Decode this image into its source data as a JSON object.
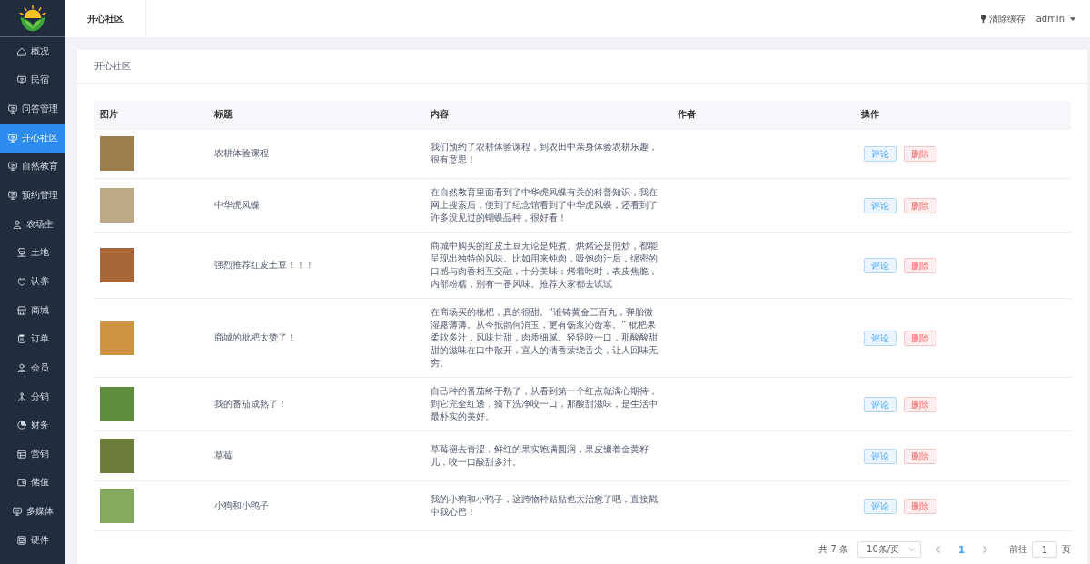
{
  "sidebar": {
    "items": [
      {
        "label": "概况",
        "selected": false
      },
      {
        "label": "民宿",
        "selected": false
      },
      {
        "label": "问答管理",
        "selected": false
      },
      {
        "label": "开心社区",
        "selected": true
      },
      {
        "label": "自然教育",
        "selected": false
      },
      {
        "label": "预约管理",
        "selected": false
      },
      {
        "label": "农场主",
        "selected": false
      },
      {
        "label": "土地",
        "selected": false
      },
      {
        "label": "认养",
        "selected": false
      },
      {
        "label": "商城",
        "selected": false
      },
      {
        "label": "订单",
        "selected": false
      },
      {
        "label": "会员",
        "selected": false
      },
      {
        "label": "分销",
        "selected": false
      },
      {
        "label": "财务",
        "selected": false
      },
      {
        "label": "营销",
        "selected": false
      },
      {
        "label": "储值",
        "selected": false
      },
      {
        "label": "多媒体",
        "selected": false
      },
      {
        "label": "硬件",
        "selected": false
      }
    ]
  },
  "header": {
    "tab": "开心社区",
    "clear_cache": "清除缓存",
    "user": "admin"
  },
  "card": {
    "title": "开心社区"
  },
  "table": {
    "columns": [
      "图片",
      "标题",
      "内容",
      "作者",
      "操作"
    ],
    "rows": [
      {
        "title": "农耕体验课程",
        "content": "我们预约了农耕体验课程，到农田中亲身体验农耕乐趣，很有意思！",
        "actions": [
          {
            "label": "评论",
            "kind": "primary"
          },
          {
            "label": "删除",
            "kind": "danger"
          }
        ]
      },
      {
        "title": "中华虎凤蝶",
        "content": "在自然教育里面看到了中华虎凤蝶有关的科普知识，我在网上搜索后，便到了纪念馆看到了中华虎凤蝶，还看到了许多没见过的蝴蝶品种，很好看！",
        "actions": [
          {
            "label": "评论",
            "kind": "primary"
          },
          {
            "label": "删除",
            "kind": "danger"
          }
        ]
      },
      {
        "title": "强烈推荐红皮土豆！！！",
        "content": "商城中购买的红皮土豆无论是炖煮、烘烤还是煎炒，都能呈现出独特的风味。比如用来炖肉，吸饱肉汁后，绵密的口感与肉香相互交融，十分美味；烤着吃时，表皮焦脆，内部粉糯，别有一番风味。推荐大家都去试试",
        "actions": [
          {
            "label": "评论",
            "kind": "primary"
          },
          {
            "label": "删除",
            "kind": "danger"
          }
        ]
      },
      {
        "title": "商城的枇杷太赞了！",
        "content": "在商场买的枇杷，真的很甜。“谁铸黄金三百丸，弹胎微湿露薄薄。从今抵鹊何消玉，更有饧浆沁齿寒。” 枇杷果柔软多汁，风味甘甜，肉质细腻。轻轻咬一口，那酸酸甜甜的滋味在口中散开，宜人的清香萦绕舌尖，让人回味无穷。",
        "actions": [
          {
            "label": "评论",
            "kind": "primary"
          },
          {
            "label": "删除",
            "kind": "danger"
          }
        ]
      },
      {
        "title": "我的番茄成熟了！",
        "content": "自己种的番茄终于熟了，从看到第一个红点就满心期待，到它完全红透，摘下洗净咬一口，那酸甜滋味，是生活中最朴实的美好。",
        "actions": [
          {
            "label": "评论",
            "kind": "primary"
          },
          {
            "label": "删除",
            "kind": "danger"
          }
        ]
      },
      {
        "title": "草莓",
        "content": "草莓褪去青涩，鲜红的果实饱满圆润，果皮缀着金黄籽儿，咬一口酸甜多汁。",
        "actions": [
          {
            "label": "评论",
            "kind": "primary"
          },
          {
            "label": "删除",
            "kind": "danger"
          }
        ]
      },
      {
        "title": "小狗和小鸭子",
        "content": "我的小狗和小鸭子，这跨物种贴贴也太治愈了吧，直接戳中我心巴！",
        "actions": [
          {
            "label": "评论",
            "kind": "primary"
          },
          {
            "label": "删除",
            "kind": "danger"
          }
        ]
      }
    ]
  },
  "pagination": {
    "total": "共 7 条",
    "page_size": "10条/页",
    "pages": [
      {
        "label": "1",
        "selected": true
      }
    ],
    "goto": "前往",
    "page_input": "1",
    "page_unit": "页"
  }
}
